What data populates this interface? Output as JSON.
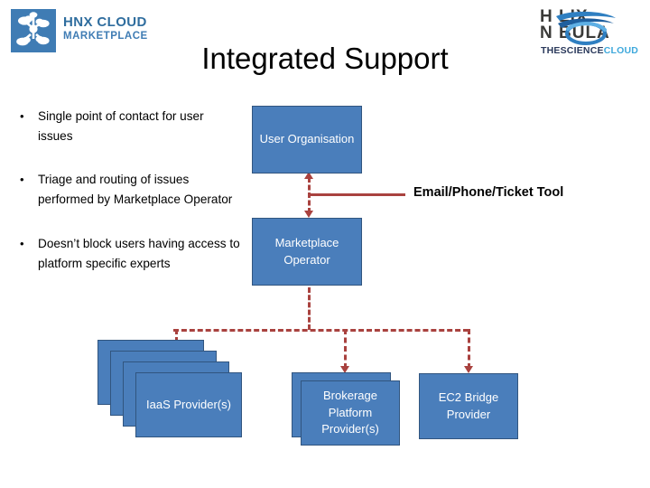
{
  "slide": {
    "title": "Integrated Support"
  },
  "logos": {
    "hnx": {
      "line1": "HNX CLOUD",
      "line2": "MARKETPLACE",
      "mark_icon": "cloud-network-icon",
      "mark_color": "#3f7cb4",
      "text_color": "#2f6d9e"
    },
    "helix_nebula": {
      "word1": "H  LIX",
      "word2": "N  BULA",
      "tagline_dark": "THESCIENCE",
      "tagline_blue": "CLOUD",
      "swirl_icon": "nebula-swirl-icon",
      "dark_color": "#2b3a5c",
      "blue_color": "#3fa9dc"
    }
  },
  "bullets": [
    "Single point of contact for user issues",
    "Triage and routing of issues performed by Marketplace Operator",
    "Doesn’t block users having access to platform specific experts"
  ],
  "diagram": {
    "box_fill": "#4a7ebb",
    "box_border": "#31557f",
    "connector_color": "#a9423f",
    "nodes": [
      {
        "id": "user-organisation",
        "label": "User Organisation"
      },
      {
        "id": "marketplace-operator",
        "label": "Marketplace Operator"
      },
      {
        "id": "iaas-provider",
        "label": "IaaS Provider(s)"
      },
      {
        "id": "brokerage-platform-provider",
        "label": "Brokerage Platform Provider(s)"
      },
      {
        "id": "ec2-bridge-provider",
        "label": "EC2 Bridge Provider"
      }
    ],
    "edge_labels": [
      {
        "id": "email-phone-ticket-tool",
        "label": "Email/Phone/Ticket Tool"
      }
    ]
  }
}
